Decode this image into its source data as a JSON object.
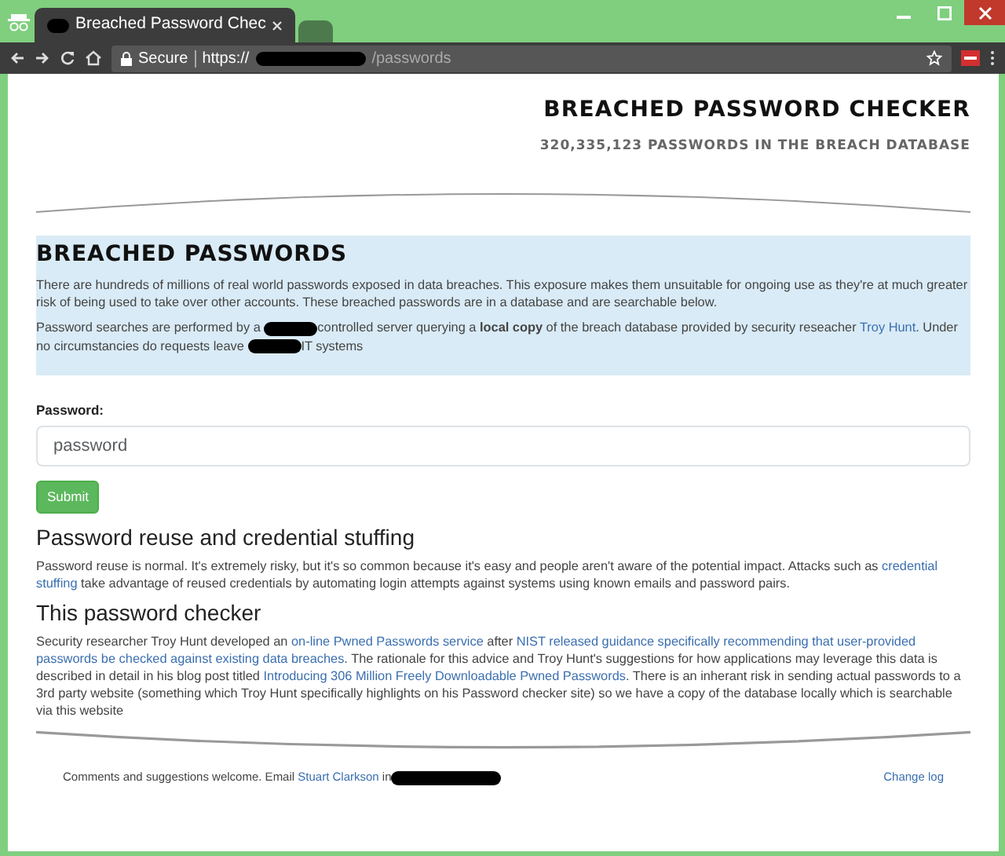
{
  "browser": {
    "tabs": [
      {
        "title": "Breached Password Chec",
        "selected": true
      },
      {
        "selected": false
      }
    ],
    "security_label": "Secure",
    "url_scheme": "https://",
    "url_path": "/passwords"
  },
  "header": {
    "title": "BREACHED PASSWORD CHECKER",
    "subtitle": "320,335,123 PASSWORDS IN THE BREACH DATABASE"
  },
  "intro": {
    "heading": "BREACHED PASSWORDS",
    "paragraphs": [
      [
        {
          "kind": "text",
          "text": "There are hundreds of millions of real world passwords exposed in data breaches. This exposure makes them unsuitable for ongoing use as they're at much greater risk of being used to take over other accounts. These breached passwords are in a database and are searchable below."
        }
      ],
      [
        {
          "kind": "text",
          "text": "Password searches are performed by a "
        },
        {
          "kind": "redaction"
        },
        {
          "kind": "text",
          "text": "controlled server querying a "
        },
        {
          "kind": "bold",
          "text": "local copy"
        },
        {
          "kind": "text",
          "text": " of the breach database provided by security reseacher "
        },
        {
          "kind": "link",
          "text": "Troy Hunt"
        },
        {
          "kind": "text",
          "text": ". Under no circumstancies do requests leave "
        },
        {
          "kind": "redaction"
        },
        {
          "kind": "text",
          "text": "IT systems"
        }
      ]
    ]
  },
  "form": {
    "label": "Password:",
    "placeholder": "password",
    "submit": "Submit"
  },
  "sections": [
    {
      "heading": "Password reuse and credential stuffing",
      "paragraph": [
        {
          "kind": "text",
          "text": "Password reuse is normal. It's extremely risky, but it's so common because it's easy and people aren't aware of the potential impact. Attacks such as "
        },
        {
          "kind": "link",
          "text": "credential"
        },
        {
          "kind": "link",
          "text": "stuffing"
        },
        {
          "kind": "text",
          "text": " take advantage of reused credentials by automating login attempts against systems using known emails and password pairs."
        }
      ]
    },
    {
      "heading": "This password checker",
      "paragraph": [
        {
          "kind": "text",
          "text": "Security researcher Troy Hunt developed an "
        },
        {
          "kind": "link",
          "text": "on-line Pwned Passwords service"
        },
        {
          "kind": "text",
          "text": " after "
        },
        {
          "kind": "link",
          "text": "NIST released guidance specifically recommending that user-provided"
        },
        {
          "kind": "link",
          "text": "passwords be checked against existing data breaches"
        },
        {
          "kind": "text",
          "text": ". The rationale for this advice and Troy Hunt's suggestions for how applications may leverage this data is described in detail in his blog post titled "
        },
        {
          "kind": "link",
          "text": "Introducing 306 Million Freely Downloadable Pwned Passwords"
        },
        {
          "kind": "text",
          "text": ". There is an inherant risk in sending actual passwords to a 3rd party website (something which Troy Hunt specifically highlights on his Password checker site) so we have a copy of the database locally which is searchable via this website"
        }
      ]
    }
  ],
  "footer": {
    "text": "Comments and suggestions welcome. Email ",
    "contact_link": "Stuart Clarkson",
    "after_link": " in",
    "changelog_link": "Change log"
  }
}
